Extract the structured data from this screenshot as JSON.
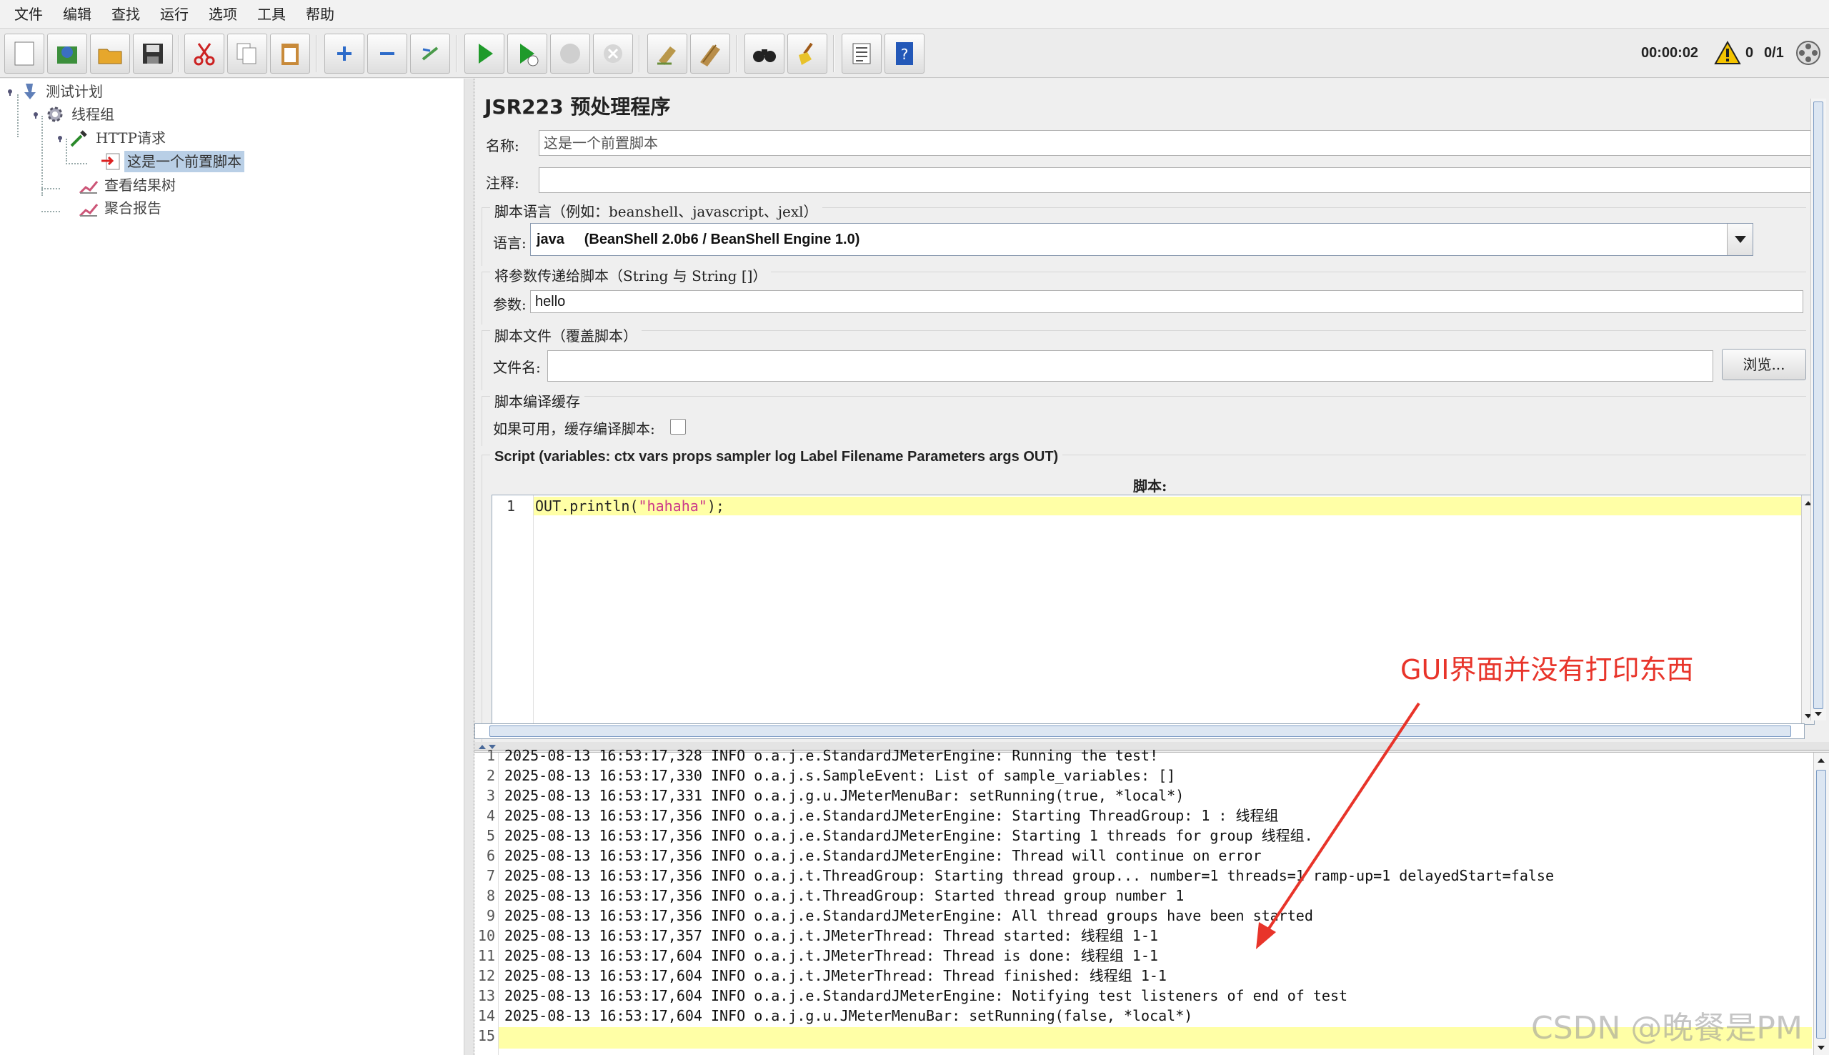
{
  "menubar": [
    "文件",
    "编辑",
    "查找",
    "运行",
    "选项",
    "工具",
    "帮助"
  ],
  "toolbar": {
    "timer": "00:00:02",
    "error_count": "0",
    "thread_count": "0/1"
  },
  "tree": {
    "test_plan": "测试计划",
    "thread_group": "线程组",
    "http_request": "HTTP请求",
    "pre_script": "这是一个前置脚本",
    "result_tree": "查看结果树",
    "aggregate": "聚合报告"
  },
  "panel": {
    "title": "JSR223 预处理程序",
    "name_label": "名称:",
    "name_value": "这是一个前置脚本",
    "comment_label": "注释:",
    "comment_value": "",
    "lang_section": "脚本语言（例如：beanshell、javascript、jexl）",
    "lang_label": "语言:",
    "lang_value": "java     (BeanShell 2.0b6 / BeanShell Engine 1.0)",
    "param_section": "将参数传递给脚本（String 与 String []）",
    "param_label": "参数:",
    "param_value": "hello",
    "file_section": "脚本文件（覆盖脚本）",
    "file_label": "文件名:",
    "file_value": "",
    "browse_label": "浏览...",
    "cache_section": "脚本编译缓存",
    "cache_label": "如果可用，缓存编译脚本:",
    "script_section": "Script (variables: ctx vars props sampler log Label Filename Parameters args OUT)",
    "script_label": "脚本:"
  },
  "editor": {
    "line_no": "1",
    "code_prefix": "OUT.println(",
    "code_string": "\"hahaha\"",
    "code_suffix": ");"
  },
  "log": {
    "line_numbers": [
      "1",
      "2",
      "3",
      "4",
      "5",
      "6",
      "7",
      "8",
      "9",
      "10",
      "11",
      "12",
      "13",
      "14",
      "15"
    ],
    "lines": [
      "2025-08-13 16:53:17,328 INFO o.a.j.e.StandardJMeterEngine: Running the test!",
      "2025-08-13 16:53:17,330 INFO o.a.j.s.SampleEvent: List of sample_variables: []",
      "2025-08-13 16:53:17,331 INFO o.a.j.g.u.JMeterMenuBar: setRunning(true, *local*)",
      "2025-08-13 16:53:17,356 INFO o.a.j.e.StandardJMeterEngine: Starting ThreadGroup: 1 : 线程组",
      "2025-08-13 16:53:17,356 INFO o.a.j.e.StandardJMeterEngine: Starting 1 threads for group 线程组.",
      "2025-08-13 16:53:17,356 INFO o.a.j.e.StandardJMeterEngine: Thread will continue on error",
      "2025-08-13 16:53:17,356 INFO o.a.j.t.ThreadGroup: Starting thread group... number=1 threads=1 ramp-up=1 delayedStart=false",
      "2025-08-13 16:53:17,356 INFO o.a.j.t.ThreadGroup: Started thread group number 1",
      "2025-08-13 16:53:17,356 INFO o.a.j.e.StandardJMeterEngine: All thread groups have been started",
      "2025-08-13 16:53:17,357 INFO o.a.j.t.JMeterThread: Thread started: 线程组 1-1",
      "2025-08-13 16:53:17,604 INFO o.a.j.t.JMeterThread: Thread is done: 线程组 1-1",
      "2025-08-13 16:53:17,604 INFO o.a.j.t.JMeterThread: Thread finished: 线程组 1-1",
      "2025-08-13 16:53:17,604 INFO o.a.j.e.StandardJMeterEngine: Notifying test listeners of end of test",
      "2025-08-13 16:53:17,604 INFO o.a.j.g.u.JMeterMenuBar: setRunning(false, *local*)",
      ""
    ]
  },
  "annotation": "GUI界面并没有打印东西",
  "watermark": "CSDN @晚餐是PM",
  "colors": {
    "annotation": "#e8342a",
    "current_line": "#ffffa6",
    "selection": "#b9cfe6",
    "string": "#cc3a8a"
  }
}
